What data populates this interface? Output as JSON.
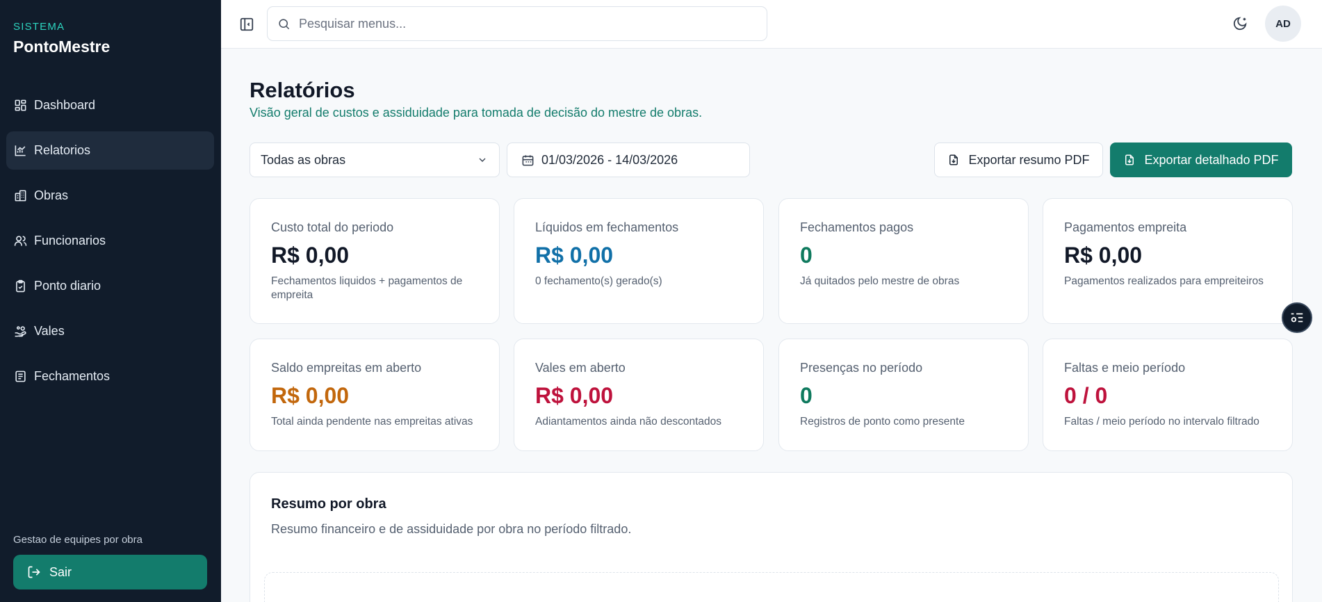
{
  "sidebar": {
    "brand_kicker": "SISTEMA",
    "brand_name": "PontoMestre",
    "items": [
      {
        "label": "Dashboard",
        "icon": "dashboard-icon",
        "active": false
      },
      {
        "label": "Relatorios",
        "icon": "chart-icon",
        "active": true
      },
      {
        "label": "Obras",
        "icon": "building-icon",
        "active": false
      },
      {
        "label": "Funcionarios",
        "icon": "users-icon",
        "active": false
      },
      {
        "label": "Ponto diario",
        "icon": "clipboard-check-icon",
        "active": false
      },
      {
        "label": "Vales",
        "icon": "hand-coins-icon",
        "active": false
      },
      {
        "label": "Fechamentos",
        "icon": "document-icon",
        "active": false
      }
    ],
    "footer_text": "Gestao de equipes por obra",
    "logout_label": "Sair"
  },
  "topbar": {
    "search_placeholder": "Pesquisar menus...",
    "avatar_initials": "AD"
  },
  "page": {
    "title": "Relatórios",
    "subtitle": "Visão geral de custos e assiduidade para tomada de decisão do mestre de obras."
  },
  "filters": {
    "obra_selected": "Todas as obras",
    "date_range": "01/03/2026 - 14/03/2026",
    "export_summary_label": "Exportar resumo PDF",
    "export_detailed_label": "Exportar detalhado PDF"
  },
  "cards": [
    {
      "label": "Custo total do periodo",
      "value": "R$ 0,00",
      "note": "Fechamentos liquidos + pagamentos de empreita"
    },
    {
      "label": "Líquidos em fechamentos",
      "value": "R$ 0,00",
      "note": "0 fechamento(s) gerado(s)"
    },
    {
      "label": "Fechamentos pagos",
      "value": "0",
      "note": "Já quitados pelo mestre de obras"
    },
    {
      "label": "Pagamentos empreita",
      "value": "R$ 0,00",
      "note": "Pagamentos realizados para empreiteiros"
    },
    {
      "label": "Saldo empreitas em aberto",
      "value": "R$ 0,00",
      "note": "Total ainda pendente nas empreitas ativas"
    },
    {
      "label": "Vales em aberto",
      "value": "R$ 0,00",
      "note": "Adiantamentos ainda não descontados"
    },
    {
      "label": "Presenças no período",
      "value": "0",
      "note": "Registros de ponto como presente"
    },
    {
      "label": "Faltas e meio período",
      "value": "0 / 0",
      "note": "Faltas / meio período no intervalo filtrado"
    }
  ],
  "summary": {
    "title": "Resumo por obra",
    "subtitle": "Resumo financeiro e de assiduidade por obra no período filtrado."
  },
  "colors": {
    "sidebar_bg": "#111c2b",
    "accent": "#137c6c",
    "blue": "#1170a8",
    "green": "#0f7a5e",
    "orange": "#c2670c",
    "red": "#be123c"
  }
}
